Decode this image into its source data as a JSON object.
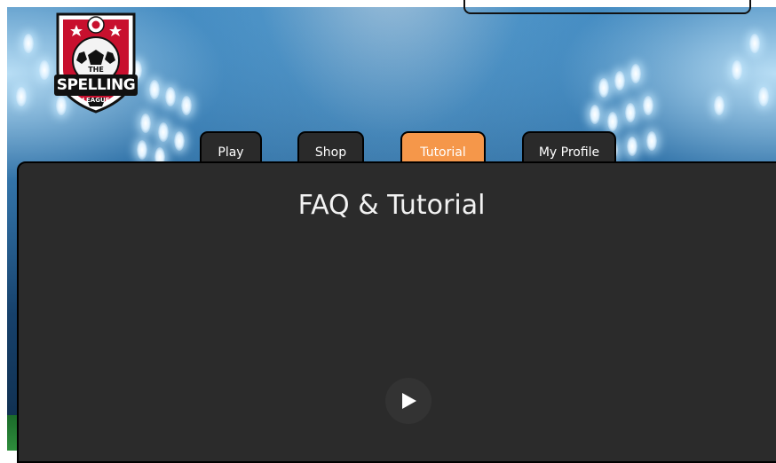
{
  "brand": {
    "logo_top": "THE",
    "logo_main": "SPELLING",
    "logo_sub": "LEAGUE"
  },
  "tabs": [
    {
      "label": "Play",
      "active": false
    },
    {
      "label": "Shop",
      "active": false
    },
    {
      "label": "Tutorial",
      "active": true
    },
    {
      "label": "My Profile",
      "active": false
    }
  ],
  "panel": {
    "title": "FAQ & Tutorial"
  },
  "video": {
    "play_icon": "play-icon"
  },
  "colors": {
    "active_tab": "#f5974a",
    "tab_bg": "#2a2a2a",
    "panel_bg": "#2b2b2b",
    "logo_red": "#c8102e"
  }
}
